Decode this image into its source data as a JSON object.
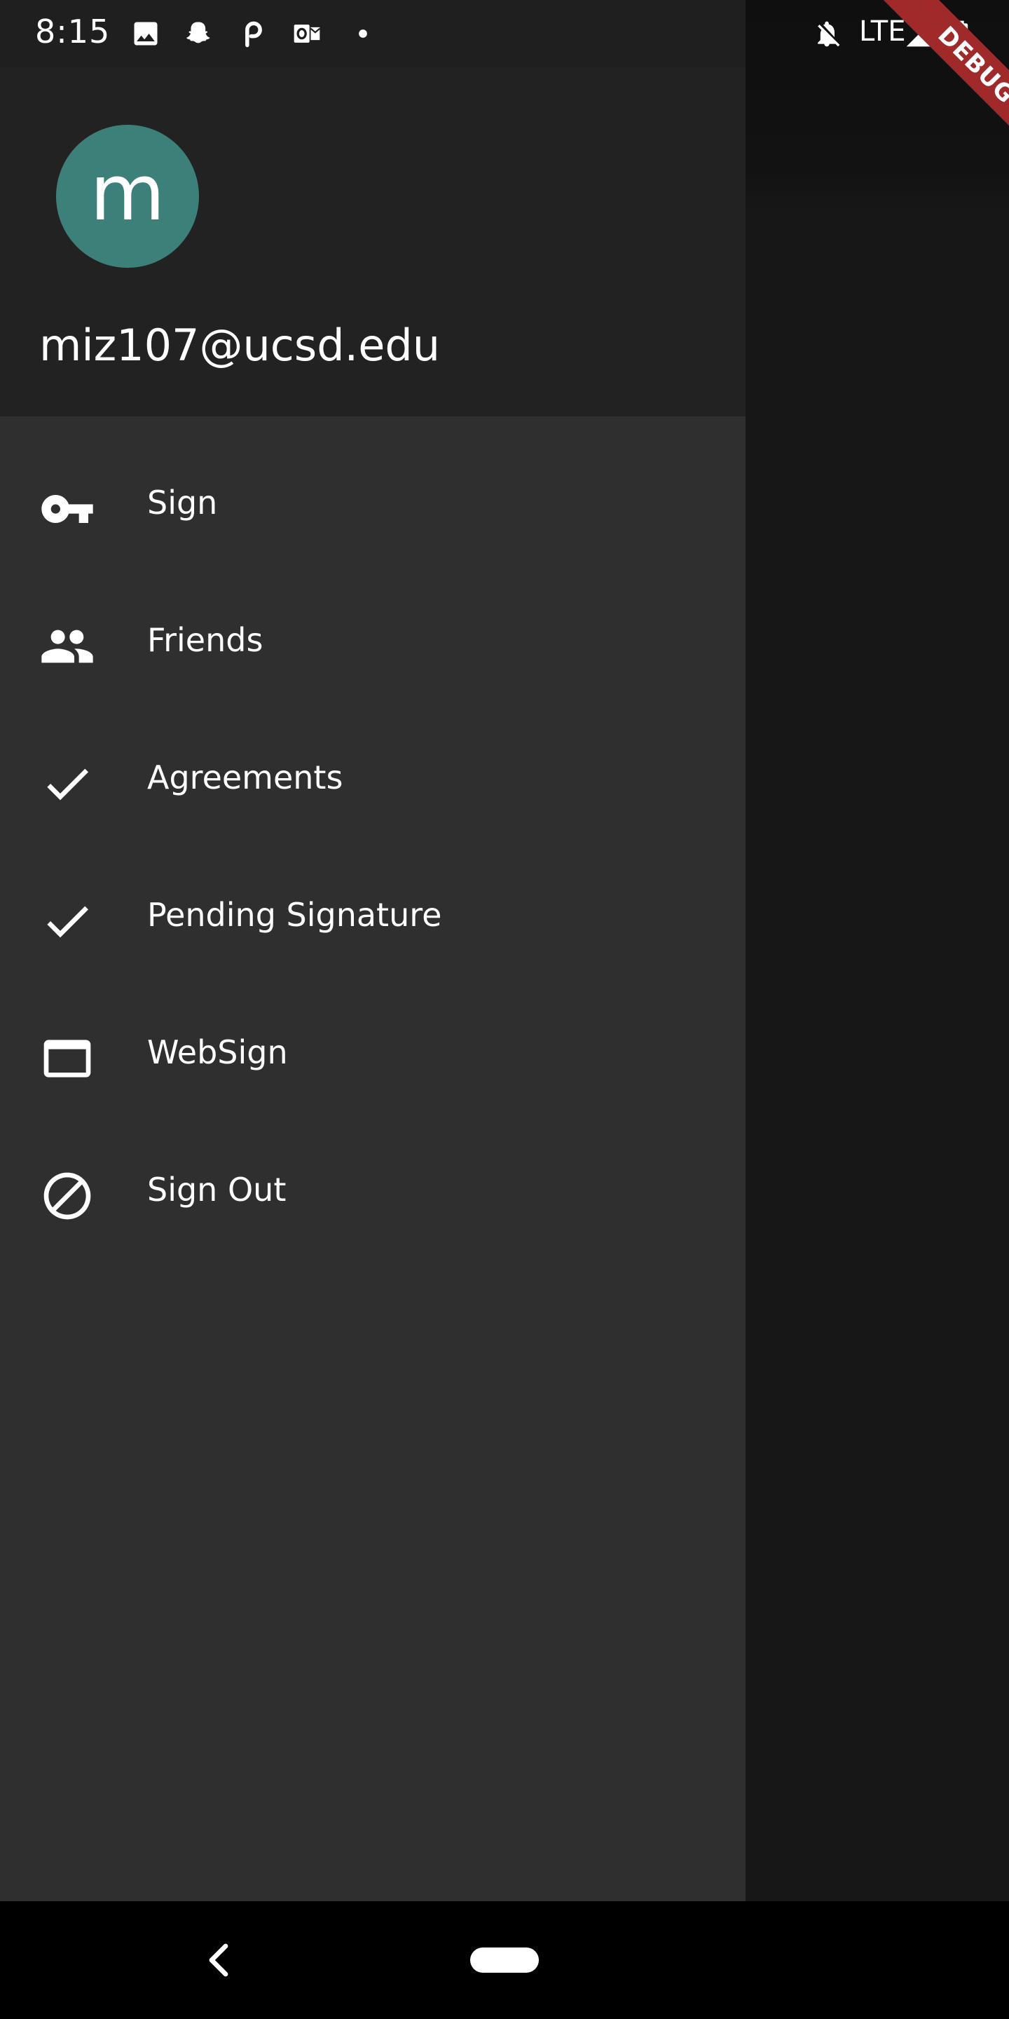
{
  "status_bar": {
    "time": "8:15",
    "left_icons": [
      "image-icon",
      "snapchat-icon",
      "p-app-icon",
      "outlook-icon",
      "dot-icon"
    ],
    "network": "LTE",
    "right_icons": [
      "notifications-off-icon",
      "signal-icon",
      "battery-charging-icon"
    ]
  },
  "debug_banner": "DEBUG",
  "drawer": {
    "avatar_letter": "m",
    "avatar_color": "#3c8079",
    "account_email": "miz107@ucsd.edu",
    "items": [
      {
        "label": "Sign",
        "icon": "key-icon"
      },
      {
        "label": "Friends",
        "icon": "people-icon"
      },
      {
        "label": "Agreements",
        "icon": "check-icon"
      },
      {
        "label": "Pending Signature",
        "icon": "check-icon"
      },
      {
        "label": "WebSign",
        "icon": "web-window-icon"
      },
      {
        "label": "Sign Out",
        "icon": "block-icon"
      }
    ]
  },
  "nav_bar": {
    "icons": [
      "back-icon",
      "home-pill-icon"
    ]
  },
  "colors": {
    "drawer_background": "#2f2f2f",
    "header_background": "#222222",
    "scrim": "#171717",
    "debug_ribbon": "#a02a2a"
  }
}
